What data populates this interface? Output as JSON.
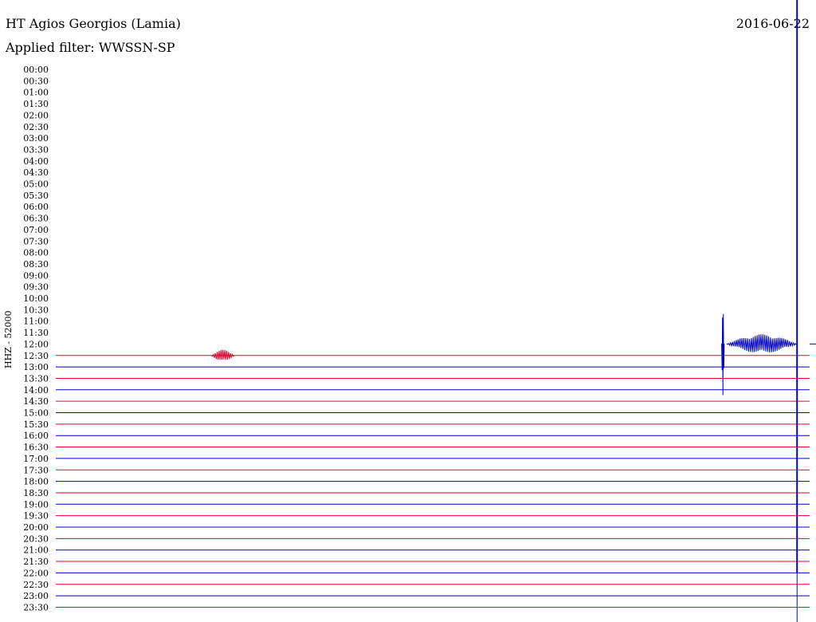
{
  "header": {
    "station": "HT Agios Georgios (Lamia)",
    "filter": "Applied filter: WWSSN-SP",
    "date": "2016-06-22"
  },
  "chart_data": {
    "type": "line",
    "title": "HT Agios Georgios (Lamia)",
    "subtitle": "Applied filter: WWSSN-SP",
    "ylabel": "HHZ - 52000",
    "date": "2016-06-22",
    "colors": {
      "odd_trace": "#e8002a",
      "even_trace": "#0000cc",
      "marker": "#0000cc"
    },
    "rows": [
      "00:00",
      "00:30",
      "01:00",
      "01:30",
      "02:00",
      "02:30",
      "03:00",
      "03:30",
      "04:00",
      "04:30",
      "05:00",
      "05:30",
      "06:00",
      "06:30",
      "07:00",
      "07:30",
      "08:00",
      "08:30",
      "09:00",
      "09:30",
      "10:00",
      "10:30",
      "11:00",
      "11:30",
      "12:00",
      "12:30",
      "13:00",
      "13:30",
      "14:00",
      "14:30",
      "15:00",
      "15:30",
      "16:00",
      "16:30",
      "17:00",
      "17:30",
      "18:00",
      "18:30",
      "19:00",
      "19:30",
      "20:00",
      "20:30",
      "21:00",
      "21:30",
      "22:00",
      "22:30",
      "23:00",
      "23:30"
    ],
    "first_trace_row": "12:00",
    "trace_start_minute": 1268,
    "end_marker": {
      "row": "22:00",
      "minute_in_row": 29.5
    },
    "events": [
      {
        "row": "12:00",
        "start_minute": 26.7,
        "end_minute": 29.5,
        "peak_up": 0.85,
        "peak_down": 0.8
      },
      {
        "row": "12:30",
        "start_minute": 6.2,
        "end_minute": 7.1,
        "peak_up": 0.5,
        "peak_down": 0.55
      },
      {
        "row": "12:00",
        "start_minute": 26.5,
        "end_minute": 26.6,
        "peak_up": 3.8,
        "peak_down": 4.6
      }
    ]
  }
}
